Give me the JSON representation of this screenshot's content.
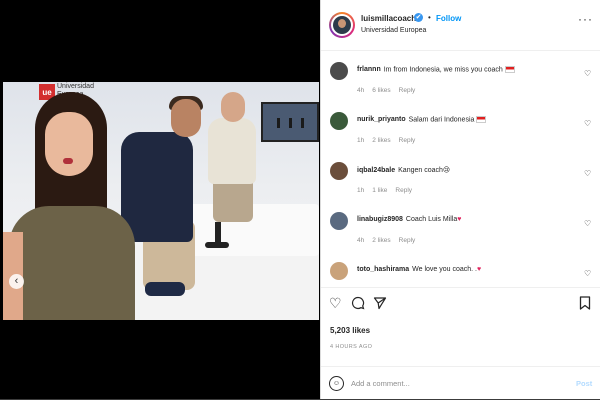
{
  "post": {
    "location_logo_text": "Universidad Europea",
    "logo_mark": "ue"
  },
  "header": {
    "username": "luismillacoach",
    "verified_glyph": "✔",
    "separator": "•",
    "follow_label": "Follow",
    "location": "Universidad Europea",
    "more_glyph": "···"
  },
  "comments": [
    {
      "user": "frlannn",
      "text": "Im from Indonesia, we miss you coach",
      "flag": true,
      "time": "4h",
      "likes": "6 likes",
      "reply": "Reply"
    },
    {
      "user": "nurik_priyanto",
      "text": "Salam dari Indonesia",
      "flag": true,
      "time": "1h",
      "likes": "2 likes",
      "reply": "Reply"
    },
    {
      "user": "iqbal24bale",
      "text": "Kangen coach😢",
      "flag": false,
      "time": "1h",
      "likes": "1 like",
      "reply": "Reply"
    },
    {
      "user": "linabugiz8908",
      "text": "Coach Luis Milla",
      "heart": "♥",
      "time": "4h",
      "likes": "2 likes",
      "reply": "Reply"
    },
    {
      "user": "toto_hashirama",
      "text": "We love you coach. .",
      "heart": "♥",
      "time": "",
      "likes": "",
      "reply": ""
    }
  ],
  "actions": {
    "like_icon": "heart-outline",
    "comment_icon": "speech-bubble",
    "share_icon": "paper-plane",
    "save_icon": "bookmark"
  },
  "likes": "5,203 likes",
  "time_ago": "4 HOURS AGO",
  "add_comment": {
    "placeholder": "Add a comment...",
    "post_label": "Post"
  },
  "media": {
    "prev_glyph": "‹"
  },
  "colors": {
    "accent": "#0095f6",
    "text": "#262626",
    "muted": "#8e8e8e"
  }
}
